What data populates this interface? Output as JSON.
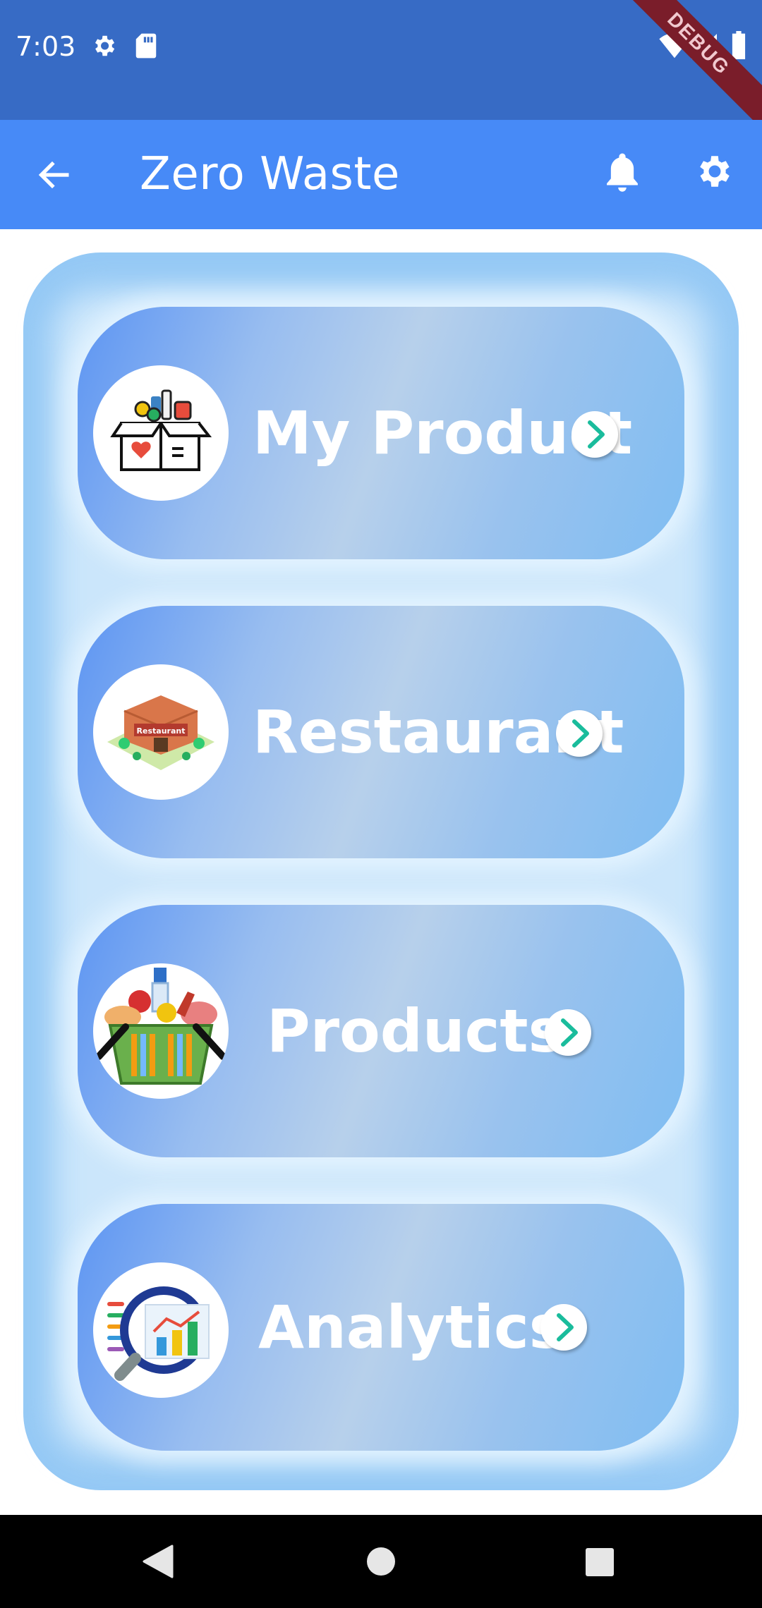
{
  "status_bar": {
    "time": "7:03",
    "debug_banner": "DEBUG"
  },
  "app_bar": {
    "title": "Zero Waste"
  },
  "menu": {
    "items": [
      {
        "label": "My Product",
        "icon": "product-box-icon"
      },
      {
        "label": "Restaurant",
        "icon": "restaurant-building-icon"
      },
      {
        "label": "Products",
        "icon": "grocery-basket-icon"
      },
      {
        "label": "Analytics",
        "icon": "analytics-chart-icon"
      }
    ]
  },
  "colors": {
    "status_bar": "#376bc5",
    "app_bar": "#478af7",
    "panel": "#95c9f5",
    "chevron": "#1abc9c"
  }
}
